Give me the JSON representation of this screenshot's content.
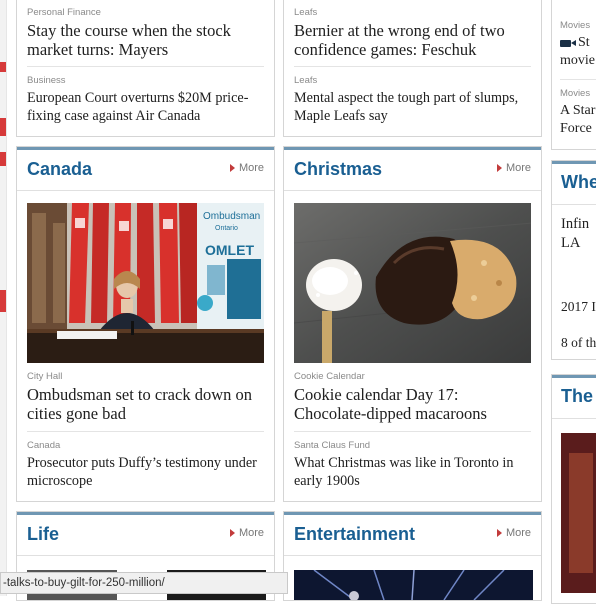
{
  "top_left_card": {
    "stories": [
      {
        "kicker": "Personal Finance",
        "headline": "Stay the course when the stock market turns: Mayers"
      },
      {
        "kicker": "Business",
        "headline": "European Court overturns $20M price-fixing case against Air Canada"
      }
    ]
  },
  "top_middle_card": {
    "stories": [
      {
        "kicker": "Leafs",
        "headline": "Bernier at the wrong end of two confidence games: Feschuk"
      },
      {
        "kicker": "Leafs",
        "headline": "Mental aspect the tough part of slumps, Maple Leafs say"
      }
    ]
  },
  "canada_section": {
    "title": "Canada",
    "more_label": "More",
    "photo": {
      "banner_brand": "Ombudsman",
      "banner_sub": "Ontario",
      "banner_word": "OMLET"
    },
    "stories": [
      {
        "kicker": "City Hall",
        "headline": "Ombudsman set to crack down on cities gone bad"
      },
      {
        "kicker": "Canada",
        "headline": "Prosecutor puts Duffy’s testimony under microscope"
      }
    ]
  },
  "christmas_section": {
    "title": "Christmas",
    "more_label": "More",
    "stories": [
      {
        "kicker": "Cookie Calendar",
        "headline": "Cookie calendar Day 17: Chocolate-dipped macaroons"
      },
      {
        "kicker": "Santa Claus Fund",
        "headline": "What Christmas was like in Toronto in early 1900s"
      }
    ]
  },
  "life_section": {
    "title": "Life",
    "more_label": "More"
  },
  "entertainment_section": {
    "title": "Entertainment",
    "more_label": "More"
  },
  "right_column": {
    "items": [
      {
        "kicker": "Movies",
        "text1": "St",
        "text2": "movie"
      },
      {
        "kicker": "Movies",
        "text1": "A Star",
        "text2": "Force"
      }
    ],
    "wher_title": "Whe",
    "wher_lines": [
      "Infin",
      "LA",
      "2017 I",
      "8 of th"
    ],
    "the_title": "The"
  },
  "status_bar": {
    "url": "-talks-to-buy-gilt-for-250-million/"
  },
  "colors": {
    "accent_blue": "#1a5f92",
    "section_rule": "#6f97b3",
    "more_arrow": "#c23b3b"
  }
}
